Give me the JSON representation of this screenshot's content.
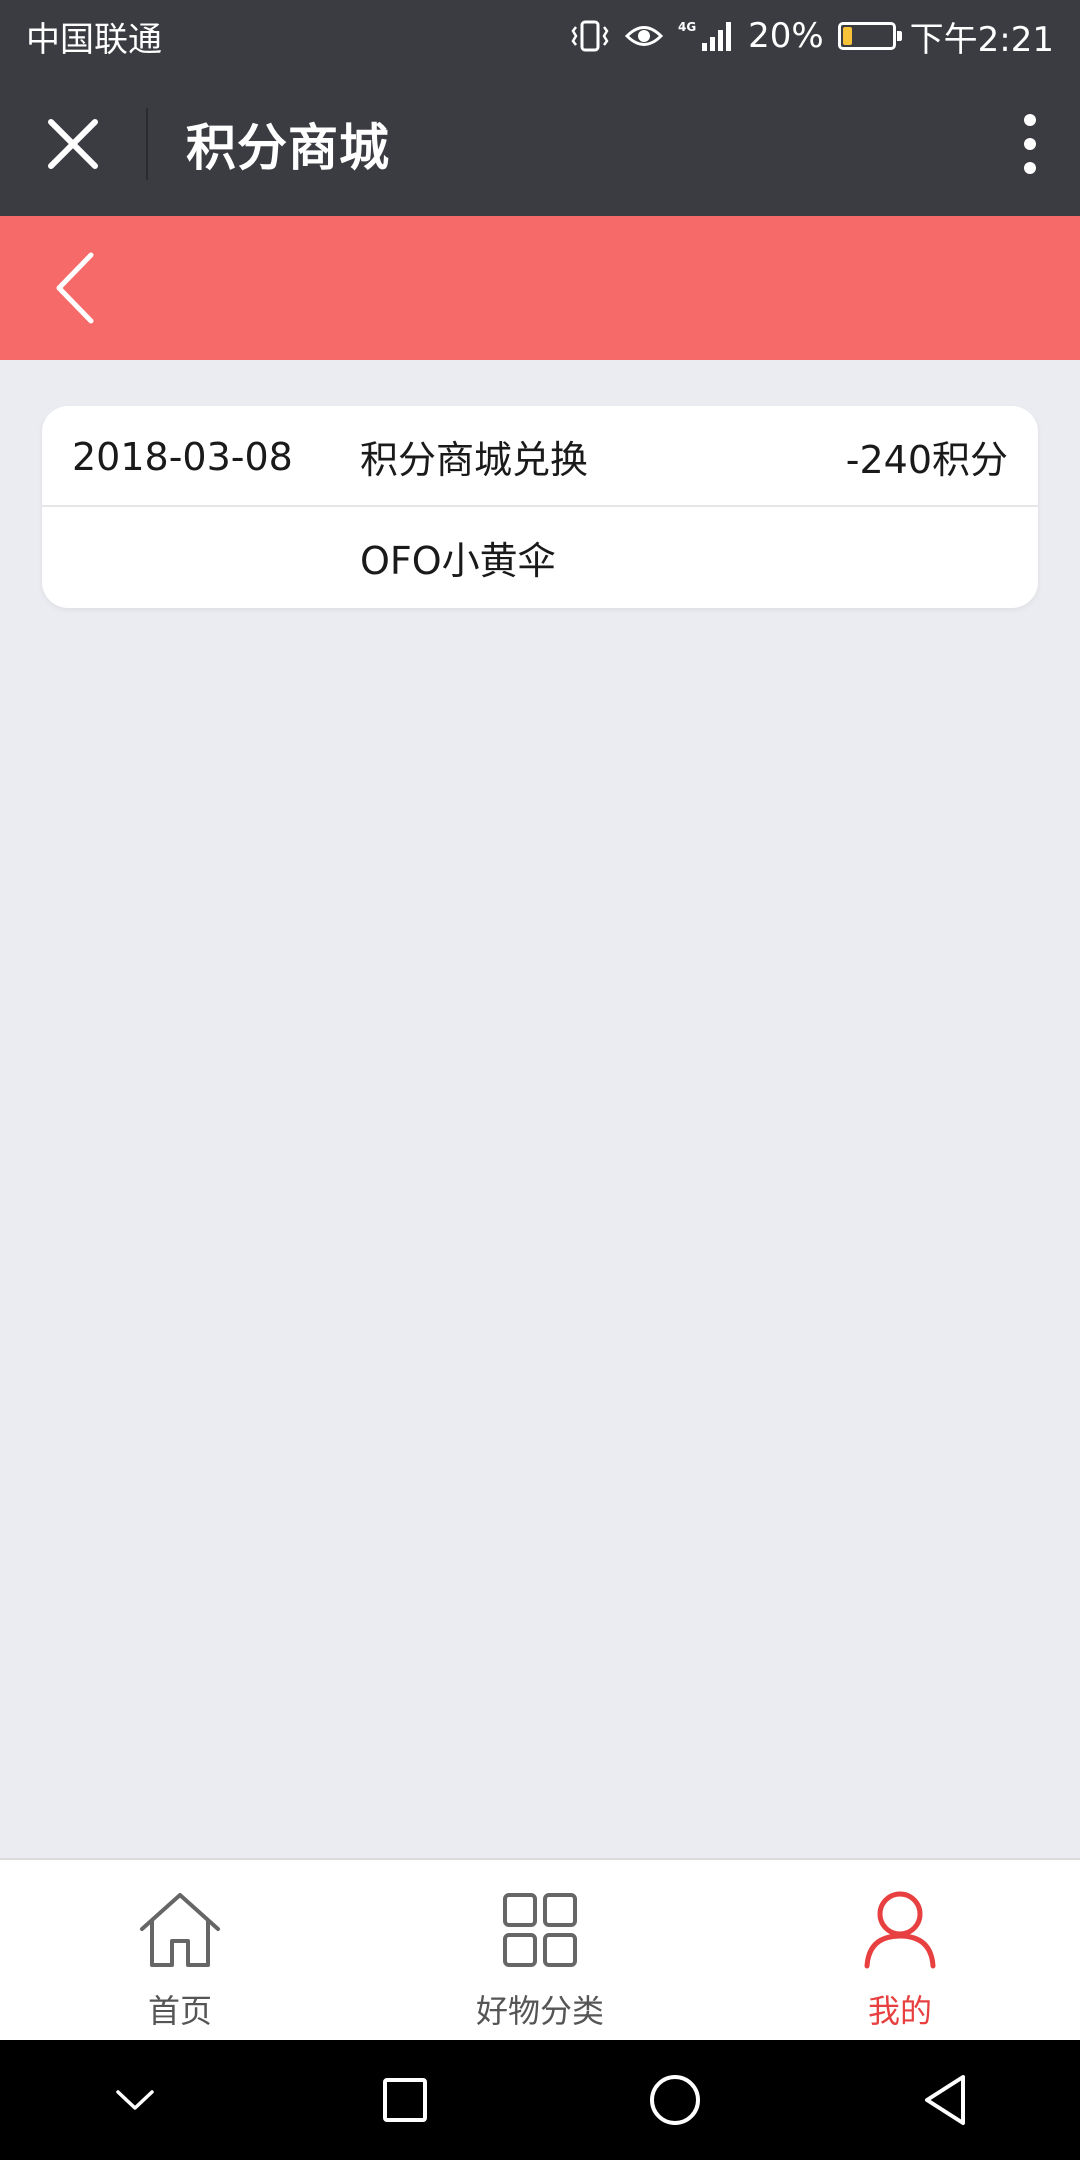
{
  "status_bar": {
    "carrier": "中国联通",
    "network": "4G",
    "battery": "20%",
    "battery_level": 0.2,
    "time": "下午2:21"
  },
  "title_bar": {
    "title": "积分商城",
    "close_icon": "close-icon",
    "more_icon": "more-vertical-icon"
  },
  "header": {
    "back_icon": "chevron-left-icon",
    "color": "#f66a6a"
  },
  "record": {
    "date": "2018-03-08",
    "type": "积分商城兑换",
    "points": "-240积分",
    "item": "OFO小黄伞"
  },
  "bottom_nav": {
    "items": [
      {
        "label": "首页",
        "icon": "home-icon",
        "active": false
      },
      {
        "label": "好物分类",
        "icon": "grid-icon",
        "active": false
      },
      {
        "label": "我的",
        "icon": "user-icon",
        "active": true
      }
    ],
    "active_color": "#e84040"
  },
  "system_nav": {
    "items": [
      "chevron-down-icon",
      "square-icon",
      "circle-icon",
      "back-triangle-icon"
    ]
  }
}
